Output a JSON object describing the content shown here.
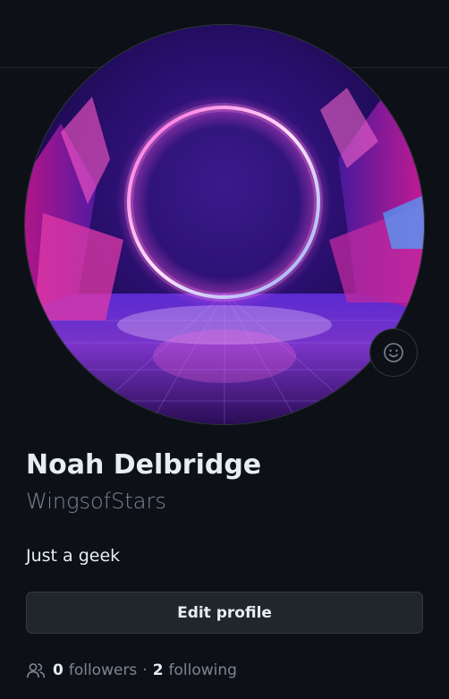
{
  "profile": {
    "name": "Noah Delbridge",
    "login": "WingsofStars",
    "bio": "Just a geek",
    "edit_profile_label": "Edit profile",
    "avatar_alt": "neon ring portal artwork"
  },
  "stats": {
    "followers_count": "0",
    "followers_label": "followers",
    "separator": "·",
    "following_count": "2",
    "following_label": "following"
  },
  "icons": {
    "status": "smiley-icon",
    "people": "people-icon"
  },
  "colors": {
    "background": "#0d1117",
    "text_primary": "#e6edf3",
    "text_muted": "#7d8590",
    "button_bg": "#21262d",
    "border": "#30363d"
  }
}
